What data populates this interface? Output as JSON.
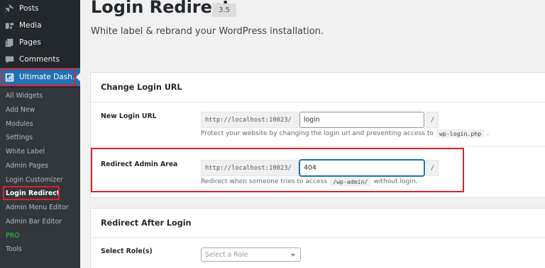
{
  "sidebar": {
    "items": [
      {
        "label": "Posts",
        "icon": "pin-icon"
      },
      {
        "label": "Media",
        "icon": "media-icon"
      },
      {
        "label": "Pages",
        "icon": "pages-icon"
      },
      {
        "label": "Comments",
        "icon": "comments-icon"
      },
      {
        "label": "Ultimate Dash…",
        "icon": "dashboard-icon"
      }
    ],
    "submenu": [
      "All Widgets",
      "Add New",
      "Modules",
      "Settings",
      "White Label",
      "Admin Pages",
      "Login Customizer",
      "Login Redirect",
      "Admin Menu Editor",
      "Admin Bar Editor",
      "PRO",
      "Tools"
    ]
  },
  "header": {
    "title": "Login Redirect",
    "version": "3.5",
    "subtitle": "White label & rebrand your WordPress installation."
  },
  "change_login": {
    "heading": "Change Login URL",
    "new_login": {
      "label": "New Login URL",
      "prefix": "http://localhost:10023/",
      "value": "login",
      "suffix": "/",
      "desc_before": "Protect your website by changing the login url and preventing access to",
      "desc_code": "wp-login.php",
      "desc_after": "."
    },
    "redirect_admin": {
      "label": "Redirect Admin Area",
      "prefix": "http://localhost:10023/",
      "value": "404",
      "suffix": "/",
      "desc_before": "Redirect when someone tries to access",
      "desc_code": "/wp-admin/",
      "desc_after": "without login."
    }
  },
  "redirect_after": {
    "heading": "Redirect After Login",
    "role_label": "Select Role(s)",
    "role_placeholder": "Select a Role"
  },
  "colors": {
    "sidebar_bg": "#23282d",
    "submenu_bg": "#32373c",
    "active_blue": "#2271b1",
    "highlight_red": "#e0202a",
    "pro_green": "#1fd34a"
  }
}
